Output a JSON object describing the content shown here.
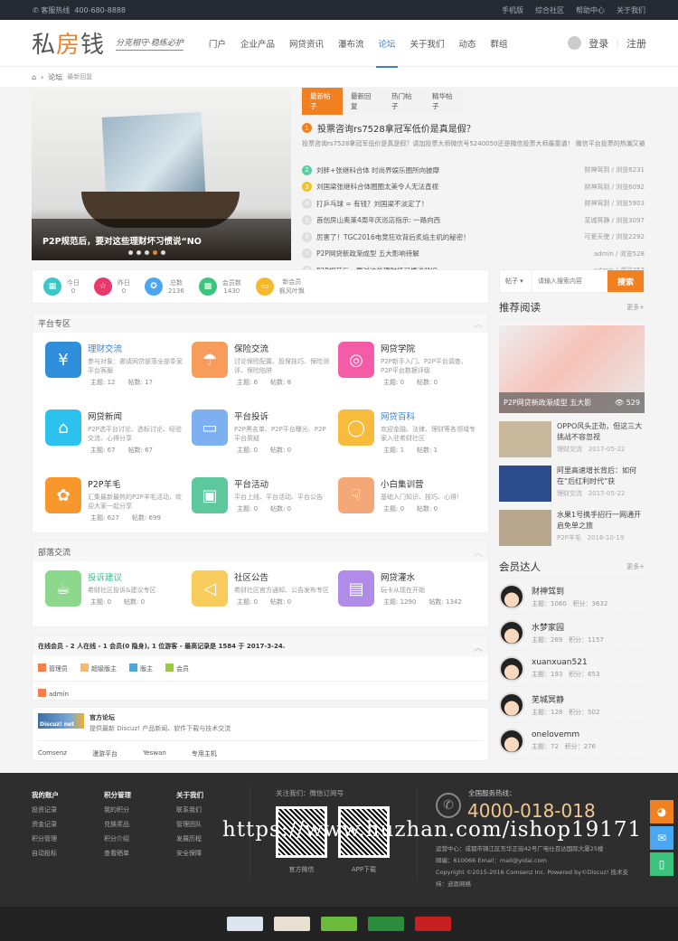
{
  "topbar": {
    "hotline_label": "客服热线",
    "hotline": "400-680-8888",
    "links": [
      "手机版",
      "综合社区",
      "帮助中心",
      "关于我们"
    ]
  },
  "header": {
    "logo": "私房钱",
    "slogan": "分克相守·稳练必护",
    "nav": [
      "门户",
      "企业产品",
      "网贷资讯",
      "瀑布流",
      "论坛",
      "关于我们",
      "动态",
      "群组"
    ],
    "active_nav": "论坛",
    "login": "登录",
    "register": "注册"
  },
  "breadcrumb": {
    "items": [
      "论坛",
      "最新回复"
    ]
  },
  "slider": {
    "caption": "P2P规范后，要对这些理财坏习惯说“NO",
    "slide_count": 5,
    "active_slide": 4
  },
  "posts": {
    "tabs": [
      "最新帖子",
      "最新回复",
      "热门帖子",
      "精华帖子"
    ],
    "active_tab": "最新帖子",
    "top": {
      "num": "1",
      "title": "投票咨询rs7528拿冠军低价是真是假？",
      "desc": "投票咨询rs7528拿冠军低价是真是假？请加投票大师微信号5240050还是微信投票大师最靠谱！ 微信平台投票的热潮又被"
    },
    "list": [
      {
        "num": "2",
        "title": "刘胖+张继科合体 时尚界娱乐圈所向披靡",
        "meta": "财神驾到 / 浏览6231",
        "color": "#5ccfa0"
      },
      {
        "num": "3",
        "title": "刘国梁张继科合体圈圈太美令人无法直视",
        "meta": "财神驾到 / 浏览6092",
        "color": "#f8c21c"
      },
      {
        "num": "4",
        "title": "打乒乓球 = 有钱？刘国梁不淡定了！",
        "meta": "财神驾到 / 浏览5903",
        "color": "#ddd"
      },
      {
        "num": "5",
        "title": "首创房山奥莱4周年庆巡店指示: 一路向西",
        "meta": "芜城冥静 / 浏览3097",
        "color": "#ddd"
      },
      {
        "num": "6",
        "title": "厉害了！TGC2016电竞狂欢背后炙焰主机的秘密！",
        "meta": "可爱天使 / 浏览2292",
        "color": "#ddd"
      },
      {
        "num": "7",
        "title": "P2P网贷新政渐成型 五大影响待解",
        "meta": "admin / 浏览528",
        "color": "#ddd"
      },
      {
        "num": "8",
        "title": "P2P规范后，要对这些理财坏习惯说“NO",
        "meta": "admin / 浏览353",
        "color": "#ddd"
      }
    ]
  },
  "stats": [
    {
      "label": "今日",
      "value": "0",
      "icon": "calendar-icon",
      "color": "#3cc6c6"
    },
    {
      "label": "昨日",
      "value": "0",
      "icon": "star-icon",
      "color": "#e8386c"
    },
    {
      "label": "总数",
      "value": "2136",
      "icon": "medal-icon",
      "color": "#4aa6f0"
    },
    {
      "label": "会员数",
      "value": "1430",
      "icon": "grid-icon",
      "color": "#3cc47c"
    },
    {
      "label": "新会员",
      "value": "枫风叶飘",
      "icon": "tv-icon",
      "color": "#f8b82c"
    }
  ],
  "platform": {
    "title": "平台专区",
    "forums": [
      {
        "name": "理财交流",
        "desc": "参与对象：邀请网贷部落全部条家平台客服",
        "topics": "主题: 12",
        "posts": "帖数: 17",
        "color": "#2f8fdc",
        "glyph": "¥",
        "style": "blue",
        "icon": "money-hand-icon"
      },
      {
        "name": "保险交流",
        "desc": "讨论保险配置、投保技巧、保险测评、保险陷阱",
        "topics": "主题: 6",
        "posts": "帖数: 8",
        "color": "#f89c5c",
        "glyph": "☂",
        "style": "",
        "icon": "umbrella-icon"
      },
      {
        "name": "网贷学院",
        "desc": "P2P新手入门、P2P平台调查、P2P平台数据评级",
        "topics": "主题: 0",
        "posts": "帖数: 0",
        "color": "#f45ca8",
        "glyph": "◎",
        "style": "",
        "icon": "target-icon"
      },
      {
        "name": "网贷新闻",
        "desc": "P2P选平台讨论、选标讨论、经验交流、心得分享",
        "topics": "主题: 67",
        "posts": "帖数: 67",
        "color": "#2cc2f0",
        "glyph": "⌂",
        "style": "",
        "icon": "book-icon"
      },
      {
        "name": "平台投诉",
        "desc": "P2P黑名单、P2P平台曝光、P2P平台质疑",
        "topics": "主题: 0",
        "posts": "帖数: 0",
        "color": "#7cb0f0",
        "glyph": "▭",
        "style": "",
        "icon": "chat-icon"
      },
      {
        "name": "网贷百科",
        "desc": "欢迎金融、法律、理财等各领域专家入驻希财社区",
        "topics": "主题: 1",
        "posts": "帖数: 1",
        "color": "#f8bc3c",
        "glyph": "◯",
        "style": "blue",
        "icon": "graduation-cap-icon"
      },
      {
        "name": "P2P羊毛",
        "desc": "汇集最新最热的P2P羊毛活动，欢迎大家一起分享",
        "topics": "主题: 627",
        "posts": "帖数: 699",
        "color": "#f8982c",
        "glyph": "✿",
        "style": "",
        "icon": "sheep-icon"
      },
      {
        "name": "平台活动",
        "desc": "平台上线、平台活动、平台公告",
        "topics": "主题: 0",
        "posts": "帖数: 0",
        "color": "#5cc89c",
        "glyph": "▣",
        "style": "",
        "icon": "gift-icon"
      },
      {
        "name": "小白集训营",
        "desc": "基础入门知识、技巧、心得！",
        "topics": "主题: 0",
        "posts": "帖数: 0",
        "color": "#f4a878",
        "glyph": "☟",
        "style": "",
        "icon": "touch-icon"
      }
    ]
  },
  "tribe": {
    "title": "部落交流",
    "forums": [
      {
        "name": "投诉建议",
        "desc": "希财社区投诉&建议专区",
        "topics": "主题: 0",
        "posts": "帖数: 0",
        "color": "#8cd88c",
        "glyph": "☕",
        "style": "green",
        "icon": "coffee-icon"
      },
      {
        "name": "社区公告",
        "desc": "希财社区官方通知、公告发布专区",
        "topics": "主题: 0",
        "posts": "帖数: 0",
        "color": "#f8cc5c",
        "glyph": "◁",
        "style": "",
        "icon": "speaker-icon"
      },
      {
        "name": "网贷灌水",
        "desc": "玩卡从现在开始",
        "topics": "主题: 1290",
        "posts": "帖数: 1342",
        "color": "#b08ce8",
        "glyph": "▤",
        "style": "",
        "icon": "card-icon"
      }
    ]
  },
  "online": {
    "title": "在线会员 - 2 人在线 - 1 会员(0 隐身), 1 位游客 - 最高记录是 1584 于 2017-3-24.",
    "legend": [
      {
        "label": "管理员",
        "color": "#f0804c"
      },
      {
        "label": "超级版主",
        "color": "#f4b870"
      },
      {
        "label": "版主",
        "color": "#4aa8e0"
      },
      {
        "label": "会员",
        "color": "#9cc83c"
      }
    ],
    "users": [
      "admin"
    ]
  },
  "links": {
    "logo_text": "Discuz! net",
    "title": "官方论坛",
    "desc": "提供最新 Discuz! 产品新闻、软件下载与技术交流",
    "items": [
      "Comsenz",
      "漫游平台",
      "Yeswan",
      "专用主机"
    ]
  },
  "search": {
    "type": "帖子",
    "placeholder": "请输入搜索内容",
    "button": "搜索"
  },
  "recommend": {
    "title": "推荐阅读",
    "more": "更多+",
    "featured": {
      "title": "P2P网贷新政渐成型 五大影",
      "views": "529"
    },
    "articles": [
      {
        "title": "OPPO风头正劲，但这三大挑战不容忽视",
        "cat": "理财交流",
        "date": "2017-05-22"
      },
      {
        "title": "阿里高速增长背后：如何在“后红利时代”获",
        "cat": "理财交流",
        "date": "2017-05-22"
      },
      {
        "title": "水果1号携手招行一网通开启免单之旅",
        "cat": "P2P羊毛",
        "date": "2016-10-19"
      }
    ]
  },
  "members": {
    "title": "会员达人",
    "more": "更多+",
    "list": [
      {
        "name": "财神驾到",
        "topics": "主题：1060",
        "score": "积分：3632"
      },
      {
        "name": "水梦家园",
        "topics": "主题：269",
        "score": "积分：1157"
      },
      {
        "name": "xuanxuan521",
        "topics": "主题：193",
        "score": "积分：653"
      },
      {
        "name": "芜城冥静",
        "topics": "主题：128",
        "score": "积分：502"
      },
      {
        "name": "onelovemm",
        "topics": "主题：72",
        "score": "积分：276"
      }
    ]
  },
  "footer": {
    "cols": [
      {
        "title": "我的账户",
        "items": [
          "投资记录",
          "资金记录",
          "积分管理",
          "自动投标"
        ]
      },
      {
        "title": "积分管理",
        "items": [
          "我的积分",
          "兑换奖品",
          "积分介绍",
          "查看晒单"
        ]
      },
      {
        "title": "关于我们",
        "items": [
          "联系我们",
          "管理团队",
          "发展历程",
          "安全保障"
        ]
      }
    ],
    "follow": "关注我们：微信订阅号",
    "qr": [
      "官方微信",
      "APP下载"
    ],
    "hotline_label": "全国服务热线：",
    "hotline": "4000-018-018",
    "ops": "运营中心：成都市锦江区东华正街42号广电仕百达国际大厦25楼",
    "mail": "邮编：610066 Email：mail@yidai.com",
    "copyright": "Copyright ©2015-2016 Comsenz Inc. Powered by©Discuz! 技术支持：迪恩网络",
    "watermark": "https://www.huzhan.com/ishop19171"
  }
}
